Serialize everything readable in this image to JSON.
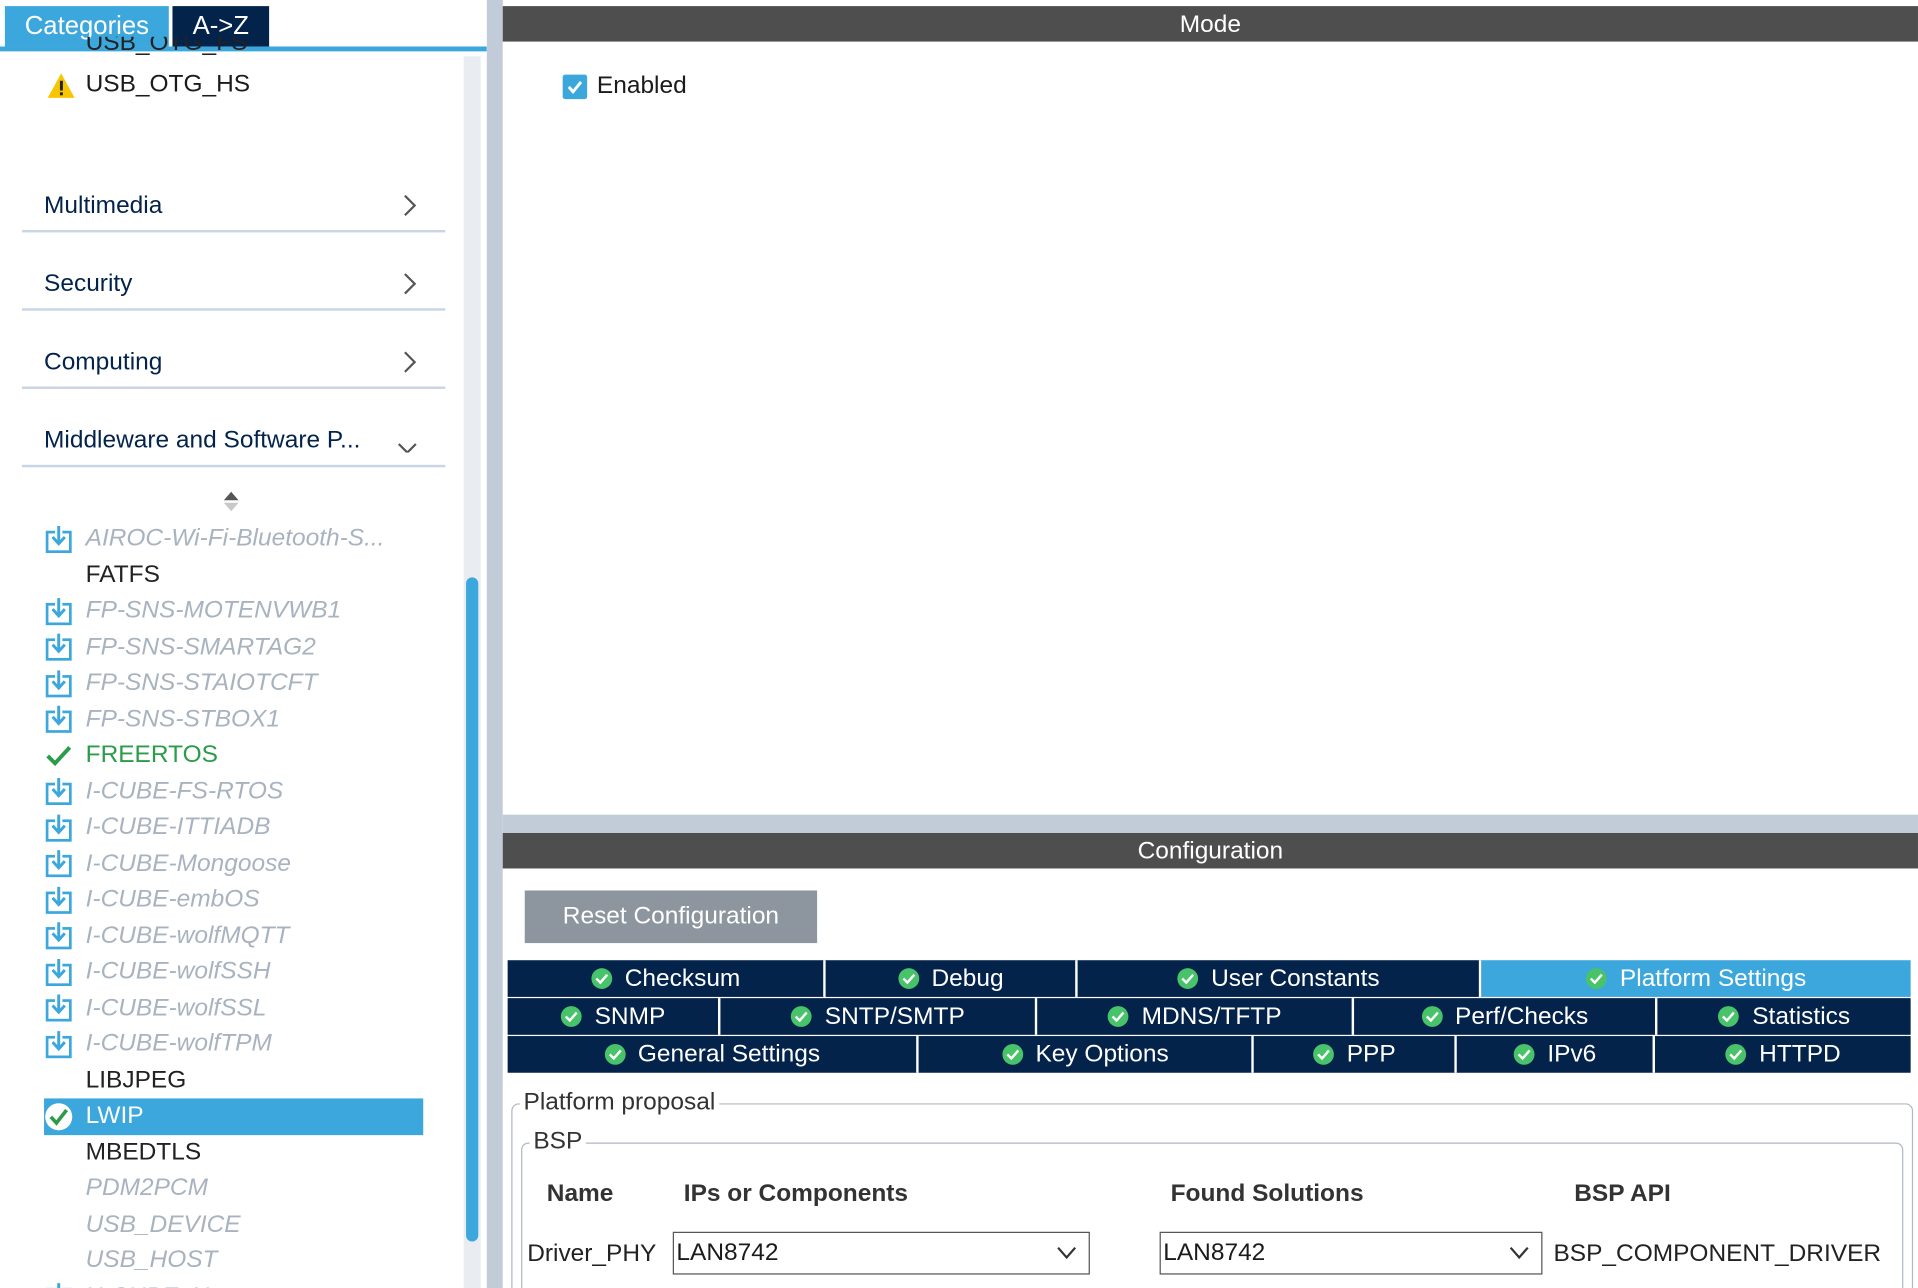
{
  "left_panel": {
    "tabs": {
      "categories": "Categories",
      "az": "A->Z"
    },
    "cut_item": "USB_OTG_FS",
    "usb_otg_hs": "USB_OTG_HS",
    "categories": [
      {
        "label": "Multimedia",
        "chevron": "right"
      },
      {
        "label": "Security",
        "chevron": "right"
      },
      {
        "label": "Computing",
        "chevron": "right"
      },
      {
        "label": "Middleware and Software P...",
        "chevron": "down"
      }
    ],
    "middleware_items": [
      {
        "label": "AIROC-Wi-Fi-Bluetooth-S...",
        "state": "download"
      },
      {
        "label": "FATFS",
        "state": "plain"
      },
      {
        "label": "FP-SNS-MOTENVWB1",
        "state": "download"
      },
      {
        "label": "FP-SNS-SMARTAG2",
        "state": "download"
      },
      {
        "label": "FP-SNS-STAIOTCFT",
        "state": "download"
      },
      {
        "label": "FP-SNS-STBOX1",
        "state": "download"
      },
      {
        "label": "FREERTOS",
        "state": "ok"
      },
      {
        "label": "I-CUBE-FS-RTOS",
        "state": "download"
      },
      {
        "label": "I-CUBE-ITTIADB",
        "state": "download"
      },
      {
        "label": "I-CUBE-Mongoose",
        "state": "download"
      },
      {
        "label": "I-CUBE-embOS",
        "state": "download"
      },
      {
        "label": "I-CUBE-wolfMQTT",
        "state": "download"
      },
      {
        "label": "I-CUBE-wolfSSH",
        "state": "download"
      },
      {
        "label": "I-CUBE-wolfSSL",
        "state": "download"
      },
      {
        "label": "I-CUBE-wolfTPM",
        "state": "download"
      },
      {
        "label": "LIBJPEG",
        "state": "plain"
      },
      {
        "label": "LWIP",
        "state": "selected"
      },
      {
        "label": "MBEDTLS",
        "state": "plain"
      },
      {
        "label": "PDM2PCM",
        "state": "ghost"
      },
      {
        "label": "USB_DEVICE",
        "state": "ghost"
      },
      {
        "label": "USB_HOST",
        "state": "ghost"
      },
      {
        "label": "X-CUBE-AI",
        "state": "download"
      }
    ]
  },
  "mode": {
    "header": "Mode",
    "enabled_label": "Enabled",
    "enabled": true
  },
  "configuration": {
    "header": "Configuration",
    "reset_label": "Reset Configuration",
    "tab_rows": [
      [
        {
          "label": "Checksum",
          "active": false
        },
        {
          "label": "Debug",
          "active": false
        },
        {
          "label": "User Constants",
          "active": false
        },
        {
          "label": "Platform Settings",
          "active": true
        }
      ],
      [
        {
          "label": "SNMP",
          "active": false
        },
        {
          "label": "SNTP/SMTP",
          "active": false
        },
        {
          "label": "MDNS/TFTP",
          "active": false
        },
        {
          "label": "Perf/Checks",
          "active": false
        },
        {
          "label": "Statistics",
          "active": false
        }
      ],
      [
        {
          "label": "General Settings",
          "active": false
        },
        {
          "label": "Key Options",
          "active": false
        },
        {
          "label": "PPP",
          "active": false
        },
        {
          "label": "IPv6",
          "active": false
        },
        {
          "label": "HTTPD",
          "active": false
        }
      ]
    ],
    "platform": {
      "legend": "Platform proposal",
      "bsp_legend": "BSP",
      "columns": [
        "Name",
        "IPs or Components",
        "Found Solutions",
        "BSP API"
      ],
      "rows": [
        {
          "name": "Driver_PHY",
          "ip": "LAN8742",
          "solution": "LAN8742",
          "api": "BSP_COMPONENT_DRIVER"
        }
      ]
    }
  },
  "colors": {
    "accent": "#3ca7dc",
    "navy": "#03234b",
    "header_gray": "#4e4e4e",
    "ok_green": "#2a9c4a",
    "disabled": "#a8b3bf"
  }
}
